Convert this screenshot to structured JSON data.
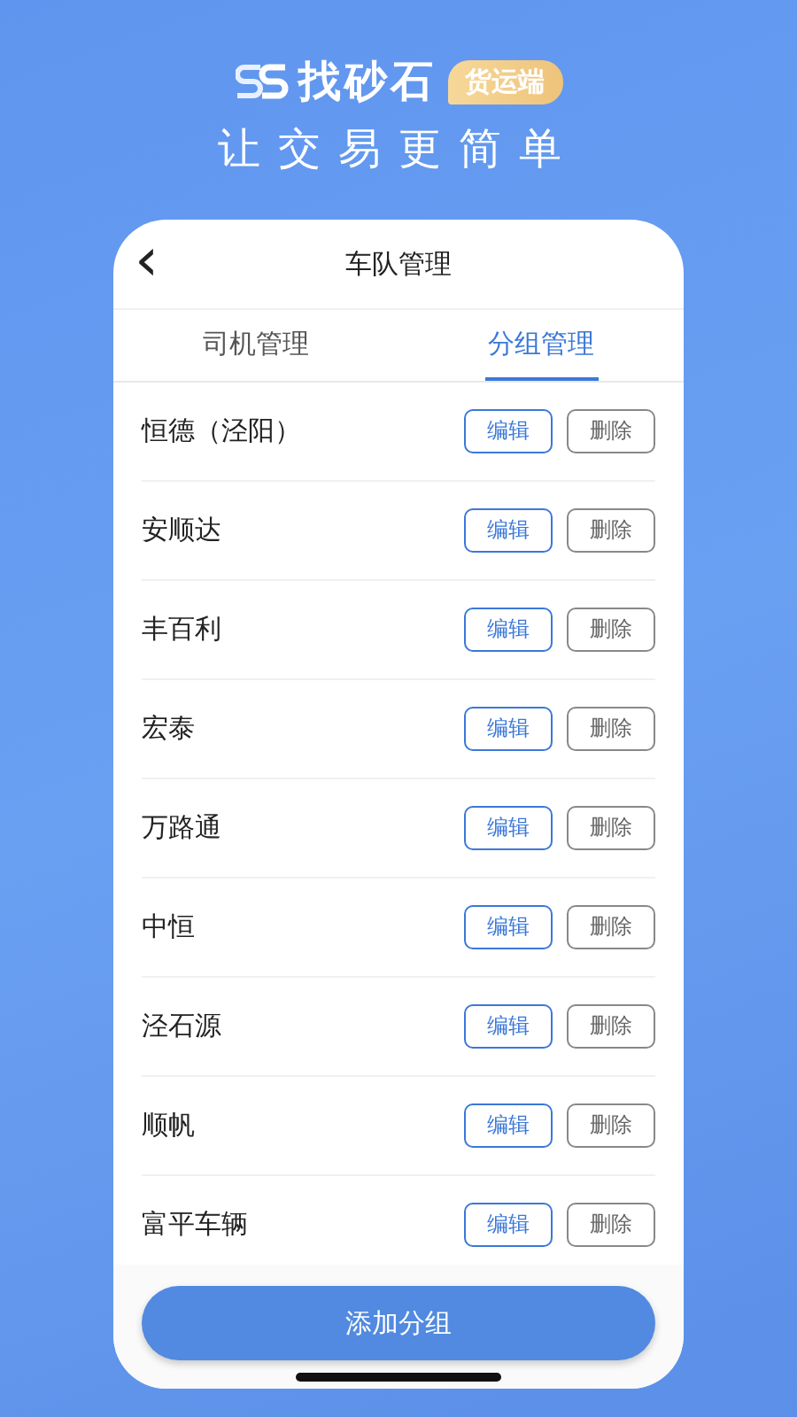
{
  "brand": {
    "name": "找砂石",
    "badge": "货运端",
    "slogan": "让交易更简单"
  },
  "header": {
    "back": "‹",
    "title": "车队管理"
  },
  "tabs": [
    {
      "label": "司机管理",
      "selected": false
    },
    {
      "label": "分组管理",
      "selected": true
    }
  ],
  "groups": [
    {
      "name": "恒德（泾阳）",
      "edit": "编辑",
      "delete": "删除"
    },
    {
      "name": "安顺达",
      "edit": "编辑",
      "delete": "删除"
    },
    {
      "name": "丰百利",
      "edit": "编辑",
      "delete": "删除"
    },
    {
      "name": "宏泰",
      "edit": "编辑",
      "delete": "删除"
    },
    {
      "name": "万路通",
      "edit": "编辑",
      "delete": "删除"
    },
    {
      "name": "中恒",
      "edit": "编辑",
      "delete": "删除"
    },
    {
      "name": "泾石源",
      "edit": "编辑",
      "delete": "删除"
    },
    {
      "name": "顺帆",
      "edit": "编辑",
      "delete": "删除"
    },
    {
      "name": "富平车辆",
      "edit": "编辑",
      "delete": "删除"
    }
  ],
  "add_button": "添加分组"
}
